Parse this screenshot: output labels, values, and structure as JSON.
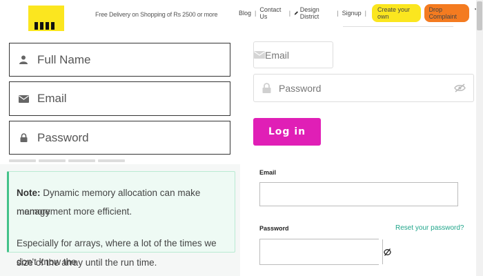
{
  "header": {
    "tagline": "Free Delivery on Shopping of Rs 2500 or more",
    "nav": {
      "blog": "Blog",
      "contact": "Contact Us",
      "design_district": "Design District",
      "signup": "Signup",
      "create_own": "Create your own",
      "drop_complaint": "Drop Complaint",
      "cart_count": "0"
    }
  },
  "left_form": {
    "full_name_placeholder": "Full Name",
    "email_placeholder": "Email",
    "password_placeholder": "Password"
  },
  "note": {
    "label": "Note:",
    "line1_rest": " Dynamic memory allocation can make memory",
    "line2": "management more efficient.",
    "line3": "Especially for arrays, where a lot of the times we don't know the",
    "line4": "size of the array until the run time."
  },
  "right_form": {
    "email_placeholder": "Email",
    "password_placeholder": "Password",
    "login_label": "Log in"
  },
  "second_form": {
    "email_label": "Email",
    "password_label": "Password",
    "reset_link": "Reset your password?"
  },
  "colors": {
    "logo_yellow": "#fbe61f",
    "drop_complaint_orange": "#f47b20",
    "login_magenta": "#e01fb6",
    "note_green": "#44c28a",
    "reset_link_teal": "#1fa58a"
  }
}
